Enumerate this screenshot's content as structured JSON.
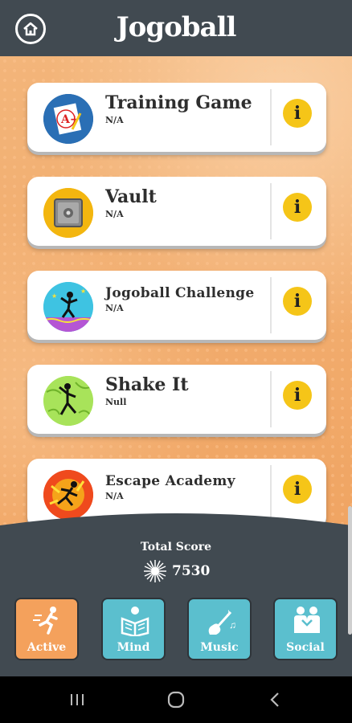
{
  "header": {
    "title": "Jogoball"
  },
  "games": [
    {
      "title": "Training Game",
      "subtitle": "N/A",
      "icon": "training-game-icon"
    },
    {
      "title": "Vault",
      "subtitle": "N/A",
      "icon": "vault-icon"
    },
    {
      "title": "Jogoball Challenge",
      "subtitle": "N/A",
      "icon": "jogoball-challenge-icon"
    },
    {
      "title": "Shake It",
      "subtitle": "Null",
      "icon": "shake-it-icon"
    },
    {
      "title": "Escape Academy",
      "subtitle": "N/A",
      "icon": "escape-academy-icon"
    }
  ],
  "info_glyph": "i",
  "score": {
    "label": "Total Score",
    "value": "7530"
  },
  "tabs": [
    {
      "label": "Active",
      "color": "#f4a15c",
      "selected": true
    },
    {
      "label": "Mind",
      "color": "#5bbfce",
      "selected": false
    },
    {
      "label": "Music",
      "color": "#5bbfce",
      "selected": false
    },
    {
      "label": "Social",
      "color": "#5bbfce",
      "selected": false
    }
  ],
  "colors": {
    "header": "#414a51",
    "info": "#f5c518",
    "active_tab": "#f4a15c",
    "inactive_tab": "#5bbfce"
  }
}
